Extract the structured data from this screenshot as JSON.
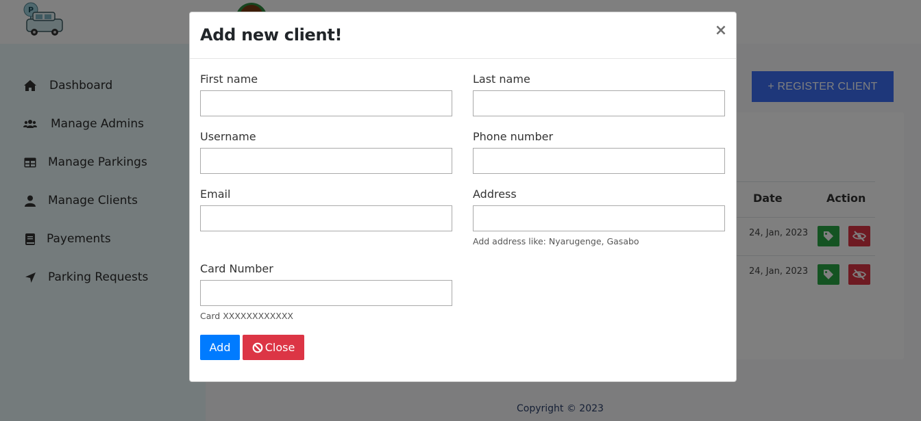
{
  "sidebar": {
    "items": [
      {
        "label": "Dashboard",
        "icon": "home-icon"
      },
      {
        "label": "Manage Admins",
        "icon": "users-icon"
      },
      {
        "label": "Manage Parkings",
        "icon": "table-icon"
      },
      {
        "label": "Manage Clients",
        "icon": "user-icon"
      },
      {
        "label": "Payements",
        "icon": "book-icon"
      },
      {
        "label": "Parking Requests",
        "icon": "location-arrow-icon"
      }
    ]
  },
  "main": {
    "register_button": "+ REGISTER CLIENT",
    "table": {
      "headers": {
        "date": "Date",
        "action": "Action"
      },
      "rows": [
        {
          "date": "24, Jan, 2023"
        },
        {
          "date": "24, Jan, 2023"
        }
      ]
    },
    "footer": "Copyright © 2023"
  },
  "modal": {
    "title": "Add new client!",
    "close_x": "×",
    "fields": {
      "first_name": {
        "label": "First name",
        "value": ""
      },
      "last_name": {
        "label": "Last name",
        "value": ""
      },
      "username": {
        "label": "Username",
        "value": ""
      },
      "phone": {
        "label": "Phone number",
        "value": ""
      },
      "email": {
        "label": "Email",
        "value": ""
      },
      "address": {
        "label": "Address",
        "value": "",
        "help": "Add address like: Nyarugenge, Gasabo"
      },
      "card": {
        "label": "Card Number",
        "value": "",
        "help": "Card XXXXXXXXXXXX"
      }
    },
    "add_button": "Add",
    "close_button": "Close"
  },
  "colors": {
    "primary": "#007bff",
    "danger": "#dc3545",
    "success": "#28a745",
    "register": "#3d6ff5",
    "sidebar_bg": "#e9f6f8"
  }
}
